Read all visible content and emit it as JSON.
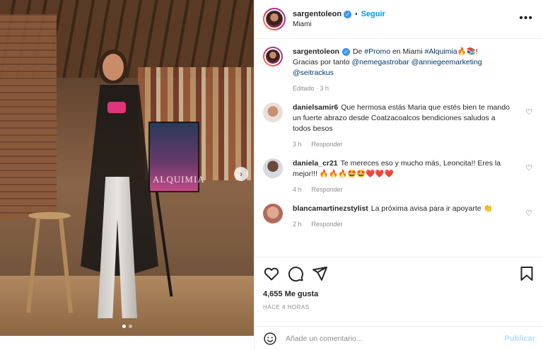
{
  "post": {
    "username": "sargentoleon",
    "follow_label": "Seguir",
    "separator": "•",
    "location": "Miami",
    "more_icon": "more-horizontal-icon",
    "poster_text": "ALQUIMIA",
    "carousel": {
      "slides": 2,
      "current": 1
    }
  },
  "caption": {
    "username": "sargentoleon",
    "text_1": "De ",
    "hashtag_promo": "#Promo",
    "text_2": " en Miami ",
    "hashtag_alquimia": "#Alquimia",
    "emojis": "🔥📚!",
    "text_3": "Gracias por tanto ",
    "mention_1": "@nemegastrobar",
    "mention_2": "@anniegeemarketing",
    "mention_3": "@seitrackus",
    "meta": "Editado · 3 h"
  },
  "comments": [
    {
      "username": "danielsamir6",
      "text": "Que hermosa estás Maria que estés bien te mando un fuerte abrazo desde Coatzacoalcos bendiciones saludos a todos besos",
      "time": "3 h",
      "reply": "Responder"
    },
    {
      "username": "daniela_cr21",
      "text": "Te mereces eso y mucho más, Leoncita!! Eres la mejor!!! 🔥🔥🔥🤩🤩❤️❤️❤️",
      "time": "4 h",
      "reply": "Responder"
    },
    {
      "username": "blancamartinezstylist",
      "text": "La próxima avisa para ir apoyarte 👏",
      "time": "2 h",
      "reply": "Responder"
    }
  ],
  "actions": {
    "likes": "4,655 Me gusta",
    "posted_ago": "HACE 4 HORAS"
  },
  "comment_box": {
    "placeholder": "Añade un comentario...",
    "publish_label": "Publicar"
  },
  "colors": {
    "link": "#0095f6",
    "tag": "#00376b",
    "muted": "#8e8e8e",
    "publish_disabled": "#b2dffc"
  }
}
